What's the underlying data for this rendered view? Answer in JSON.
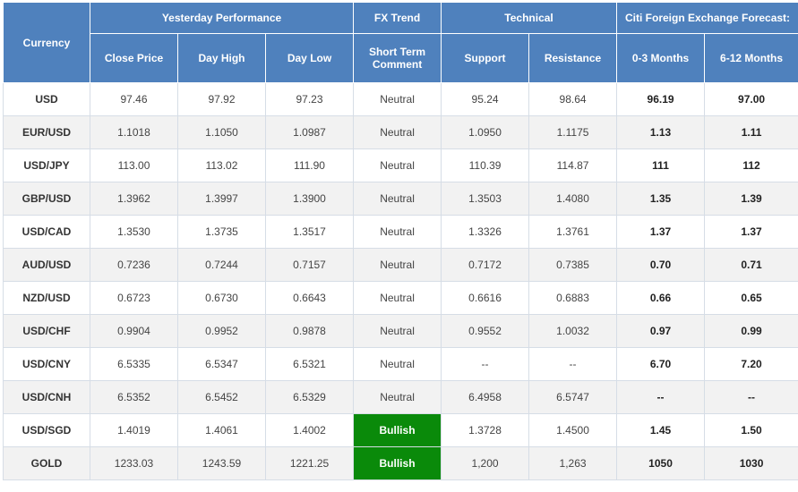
{
  "header": {
    "currency": "Currency",
    "groups": {
      "yesterday": "Yesterday Performance",
      "fx_trend": "FX Trend",
      "technical": "Technical",
      "forecast": "Citi Foreign Exchange Forecast:"
    },
    "columns": [
      "Close Price",
      "Day High",
      "Day Low",
      "Short Term Comment",
      "Support",
      "Resistance",
      "0-3 Months",
      "6-12 Months"
    ]
  },
  "colors": {
    "header_bg": "#4f81bd",
    "bullish_bg": "#0a8a0a"
  },
  "rows": [
    [
      "USD",
      "97.46",
      "97.92",
      "97.23",
      "Neutral",
      "95.24",
      "98.64",
      "96.19",
      "97.00"
    ],
    [
      "EUR/USD",
      "1.1018",
      "1.1050",
      "1.0987",
      "Neutral",
      "1.0950",
      "1.1175",
      "1.13",
      "1.11"
    ],
    [
      "USD/JPY",
      "113.00",
      "113.02",
      "111.90",
      "Neutral",
      "110.39",
      "114.87",
      "111",
      "112"
    ],
    [
      "GBP/USD",
      "1.3962",
      "1.3997",
      "1.3900",
      "Neutral",
      "1.3503",
      "1.4080",
      "1.35",
      "1.39"
    ],
    [
      "USD/CAD",
      "1.3530",
      "1.3735",
      "1.3517",
      "Neutral",
      "1.3326",
      "1.3761",
      "1.37",
      "1.37"
    ],
    [
      "AUD/USD",
      "0.7236",
      "0.7244",
      "0.7157",
      "Neutral",
      "0.7172",
      "0.7385",
      "0.70",
      "0.71"
    ],
    [
      "NZD/USD",
      "0.6723",
      "0.6730",
      "0.6643",
      "Neutral",
      "0.6616",
      "0.6883",
      "0.66",
      "0.65"
    ],
    [
      "USD/CHF",
      "0.9904",
      "0.9952",
      "0.9878",
      "Neutral",
      "0.9552",
      "1.0032",
      "0.97",
      "0.99"
    ],
    [
      "USD/CNY",
      "6.5335",
      "6.5347",
      "6.5321",
      "Neutral",
      "--",
      "--",
      "6.70",
      "7.20"
    ],
    [
      "USD/CNH",
      "6.5352",
      "6.5452",
      "6.5329",
      "Neutral",
      "6.4958",
      "6.5747",
      "--",
      "--"
    ],
    [
      "USD/SGD",
      "1.4019",
      "1.4061",
      "1.4002",
      "Bullish",
      "1.3728",
      "1.4500",
      "1.45",
      "1.50"
    ],
    [
      "GOLD",
      "1233.03",
      "1243.59",
      "1221.25",
      "Bullish",
      "1,200",
      "1,263",
      "1050",
      "1030"
    ]
  ]
}
